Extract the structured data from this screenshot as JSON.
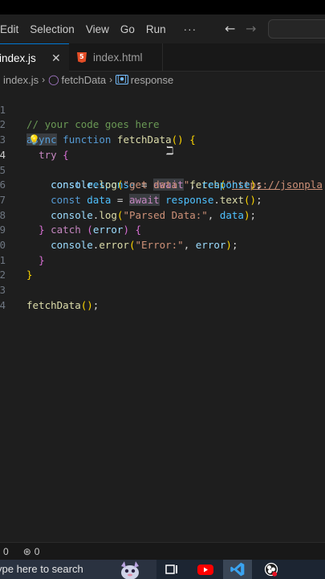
{
  "menubar": {
    "items": [
      "Edit",
      "Selection",
      "View",
      "Go",
      "Run",
      "···"
    ]
  },
  "tabs": [
    {
      "label": "index.js",
      "active": true
    },
    {
      "label": "index.html",
      "active": false
    }
  ],
  "tab_close_glyph": "✕",
  "breadcrumb": {
    "file": "index.js",
    "function": "fetchData",
    "variable": "response"
  },
  "editor": {
    "line_numbers": [
      "1",
      "2",
      "3",
      "4",
      "5",
      "6",
      "7",
      "8",
      "9",
      "0",
      "1",
      "2",
      "3",
      "4"
    ],
    "current_line_index": 3
  },
  "code": {
    "l1_comment": "// your code goes here",
    "l2_async": "async",
    "l2_function": "function",
    "l2_name": "fetchData",
    "l2_parens": "()",
    "l2_brace": "{",
    "l3_try": "try",
    "l3_brace": "{",
    "l4_const": "const",
    "l4_var": "response",
    "l4_eq": "=",
    "l4_await": "await",
    "l4_fetch": "fetch",
    "l4_paren": "(",
    "l4_url_q": "\"",
    "l4_url": "https://jsonpla",
    "l5_console": "console",
    "l5_log": "log",
    "l5_str": "\"get data \"",
    "l5_arg": "response",
    "l6_const": "const",
    "l6_var": "data",
    "l6_await": "await",
    "l6_obj": "response",
    "l6_method": "text",
    "l7_console": "console",
    "l7_log": "log",
    "l7_str": "\"Parsed Data:\"",
    "l7_arg": "data",
    "l8_catch": "catch",
    "l8_err": "error",
    "l9_console": "console",
    "l9_method": "error",
    "l9_str": "\"Error:\"",
    "l9_arg": "error",
    "l13_call": "fetchData"
  },
  "statusbar": {
    "errors": "0",
    "ports": "0"
  },
  "taskbar": {
    "search_placeholder": "ype here to search"
  },
  "colors": {
    "keyword": "#569cd6",
    "control": "#c586c0",
    "function": "#dcdcaa",
    "variable": "#9cdcfe",
    "string": "#ce9178",
    "comment": "#6a9955",
    "accent": "#0078d4"
  }
}
